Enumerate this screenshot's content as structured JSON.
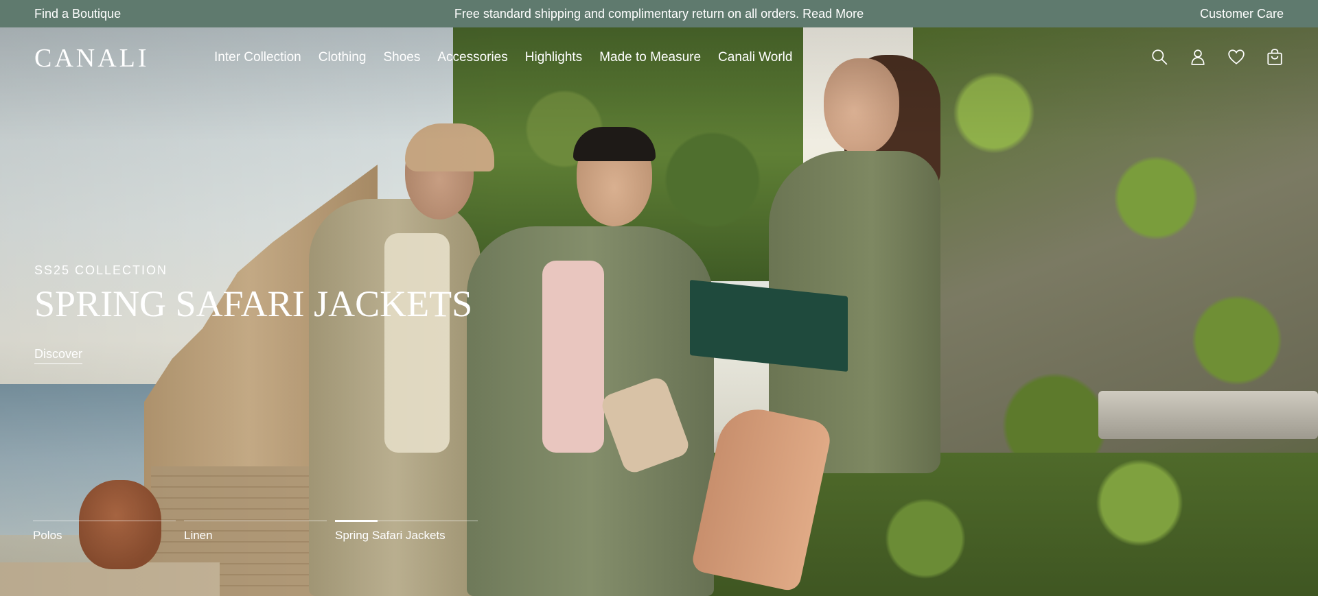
{
  "topbar": {
    "left_link": "Find a Boutique",
    "center_text": "Free standard shipping and complimentary return on all orders. Read More",
    "right_link": "Customer Care",
    "bg_color": "#5f7a6e"
  },
  "header": {
    "logo": "CANALI",
    "nav": [
      "Inter Collection",
      "Clothing",
      "Shoes",
      "Accessories",
      "Highlights",
      "Made to Measure",
      "Canali World"
    ],
    "icons": [
      "search-icon",
      "account-icon",
      "wishlist-heart-icon",
      "shopping-bag-icon"
    ]
  },
  "hero": {
    "eyebrow": "SS25 COLLECTION",
    "headline": "SPRING SAFARI JACKETS",
    "cta": "Discover"
  },
  "slides": {
    "items": [
      {
        "label": "Polos",
        "progress": 0
      },
      {
        "label": "Linen",
        "progress": 0
      },
      {
        "label": "Spring Safari Jackets",
        "progress": 0.3
      }
    ]
  }
}
